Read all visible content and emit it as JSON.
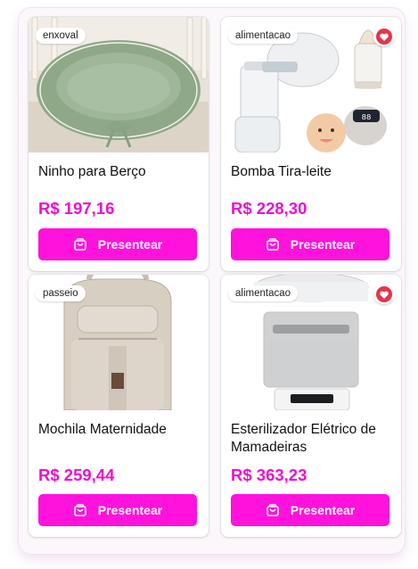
{
  "products": [
    {
      "tag": "enxoval",
      "title": "Ninho para Berço",
      "price": "R$ 197,16",
      "button": "Presentear",
      "favorite": false
    },
    {
      "tag": "alimentacao",
      "title": "Bomba Tira-leite",
      "price": "R$ 228,30",
      "button": "Presentear",
      "favorite": true
    },
    {
      "tag": "passeio",
      "title": "Mochila Maternidade",
      "price": "R$ 259,44",
      "button": "Presentear",
      "favorite": false
    },
    {
      "tag": "alimentacao",
      "title": "Esterilizador Elétrico de Mamadeiras",
      "price": "R$ 363,23",
      "button": "Presentear",
      "favorite": true
    }
  ],
  "icons": {
    "button": "gift-bag-icon",
    "favorite": "heart-icon"
  },
  "colors": {
    "accent": "#ff12dc",
    "price": "#ec10d2",
    "heart": "#e8334a"
  }
}
